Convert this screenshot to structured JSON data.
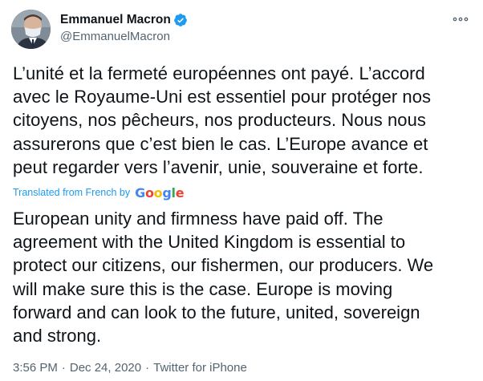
{
  "author": {
    "display_name": "Emmanuel Macron",
    "handle": "@EmmanuelMacron",
    "verified": true
  },
  "tweet": {
    "original_lines": [
      "L’unité et la fermeté européennes ont payé. L’accord",
      "avec le Royaume-Uni est essentiel pour protéger nos",
      "citoyens, nos pêcheurs, nos producteurs. Nous nous",
      "assurerons que c’est bien le cas. L’Europe avance et",
      "peut regarder vers l’avenir, unie, souveraine et forte."
    ],
    "translated_label": "Translated from French by",
    "translator": "Google",
    "translation_lines": [
      "European unity and firmness have paid off. The",
      "agreement with the United Kingdom is essential to",
      "protect our citizens, our fishermen, our producers. We",
      "will make sure this is the case. Europe is moving",
      "forward and can look to the future, united, sovereign",
      "and strong."
    ]
  },
  "meta": {
    "time": "3:56 PM",
    "date": "Dec 24, 2020",
    "separator": "·",
    "source": "Twitter for iPhone"
  },
  "colors": {
    "accent": "#1d9bf0",
    "text": "#0f1419",
    "secondary": "#536471"
  },
  "icons": {
    "verified": "verified-badge-icon",
    "more": "more-options-icon"
  }
}
